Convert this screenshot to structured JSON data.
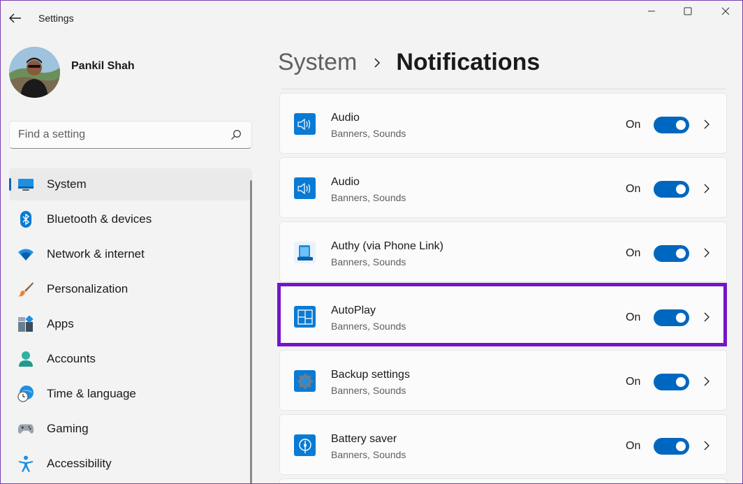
{
  "window": {
    "title": "Settings"
  },
  "profile": {
    "name": "Pankil Shah"
  },
  "search": {
    "placeholder": "Find a setting"
  },
  "sidebar": {
    "items": [
      {
        "label": "System",
        "icon": "system-display-icon",
        "active": true
      },
      {
        "label": "Bluetooth & devices",
        "icon": "bluetooth-icon"
      },
      {
        "label": "Network & internet",
        "icon": "wifi-icon"
      },
      {
        "label": "Personalization",
        "icon": "brush-icon"
      },
      {
        "label": "Apps",
        "icon": "apps-icon"
      },
      {
        "label": "Accounts",
        "icon": "account-icon"
      },
      {
        "label": "Time & language",
        "icon": "globe-clock-icon"
      },
      {
        "label": "Gaming",
        "icon": "gamepad-icon"
      },
      {
        "label": "Accessibility",
        "icon": "accessibility-icon"
      }
    ]
  },
  "header": {
    "parent": "System",
    "current": "Notifications"
  },
  "notifications": [
    {
      "name": "Audio",
      "subtitle": "Banners, Sounds",
      "state": "On",
      "enabled": true,
      "icon": "speaker-icon"
    },
    {
      "name": "Audio",
      "subtitle": "Banners, Sounds",
      "state": "On",
      "enabled": true,
      "icon": "speaker-icon"
    },
    {
      "name": "Authy (via Phone Link)",
      "subtitle": "Banners, Sounds",
      "state": "On",
      "enabled": true,
      "icon": "phone-link-icon"
    },
    {
      "name": "AutoPlay",
      "subtitle": "Banners, Sounds",
      "state": "On",
      "enabled": true,
      "icon": "autoplay-icon",
      "highlighted": true
    },
    {
      "name": "Backup settings",
      "subtitle": "Banners, Sounds",
      "state": "On",
      "enabled": true,
      "icon": "backup-gear-icon"
    },
    {
      "name": "Battery saver",
      "subtitle": "Banners, Sounds",
      "state": "On",
      "enabled": true,
      "icon": "battery-saver-icon"
    }
  ],
  "colors": {
    "accent": "#0067c0",
    "highlight": "#7414c8",
    "background": "#f3f3f3"
  }
}
